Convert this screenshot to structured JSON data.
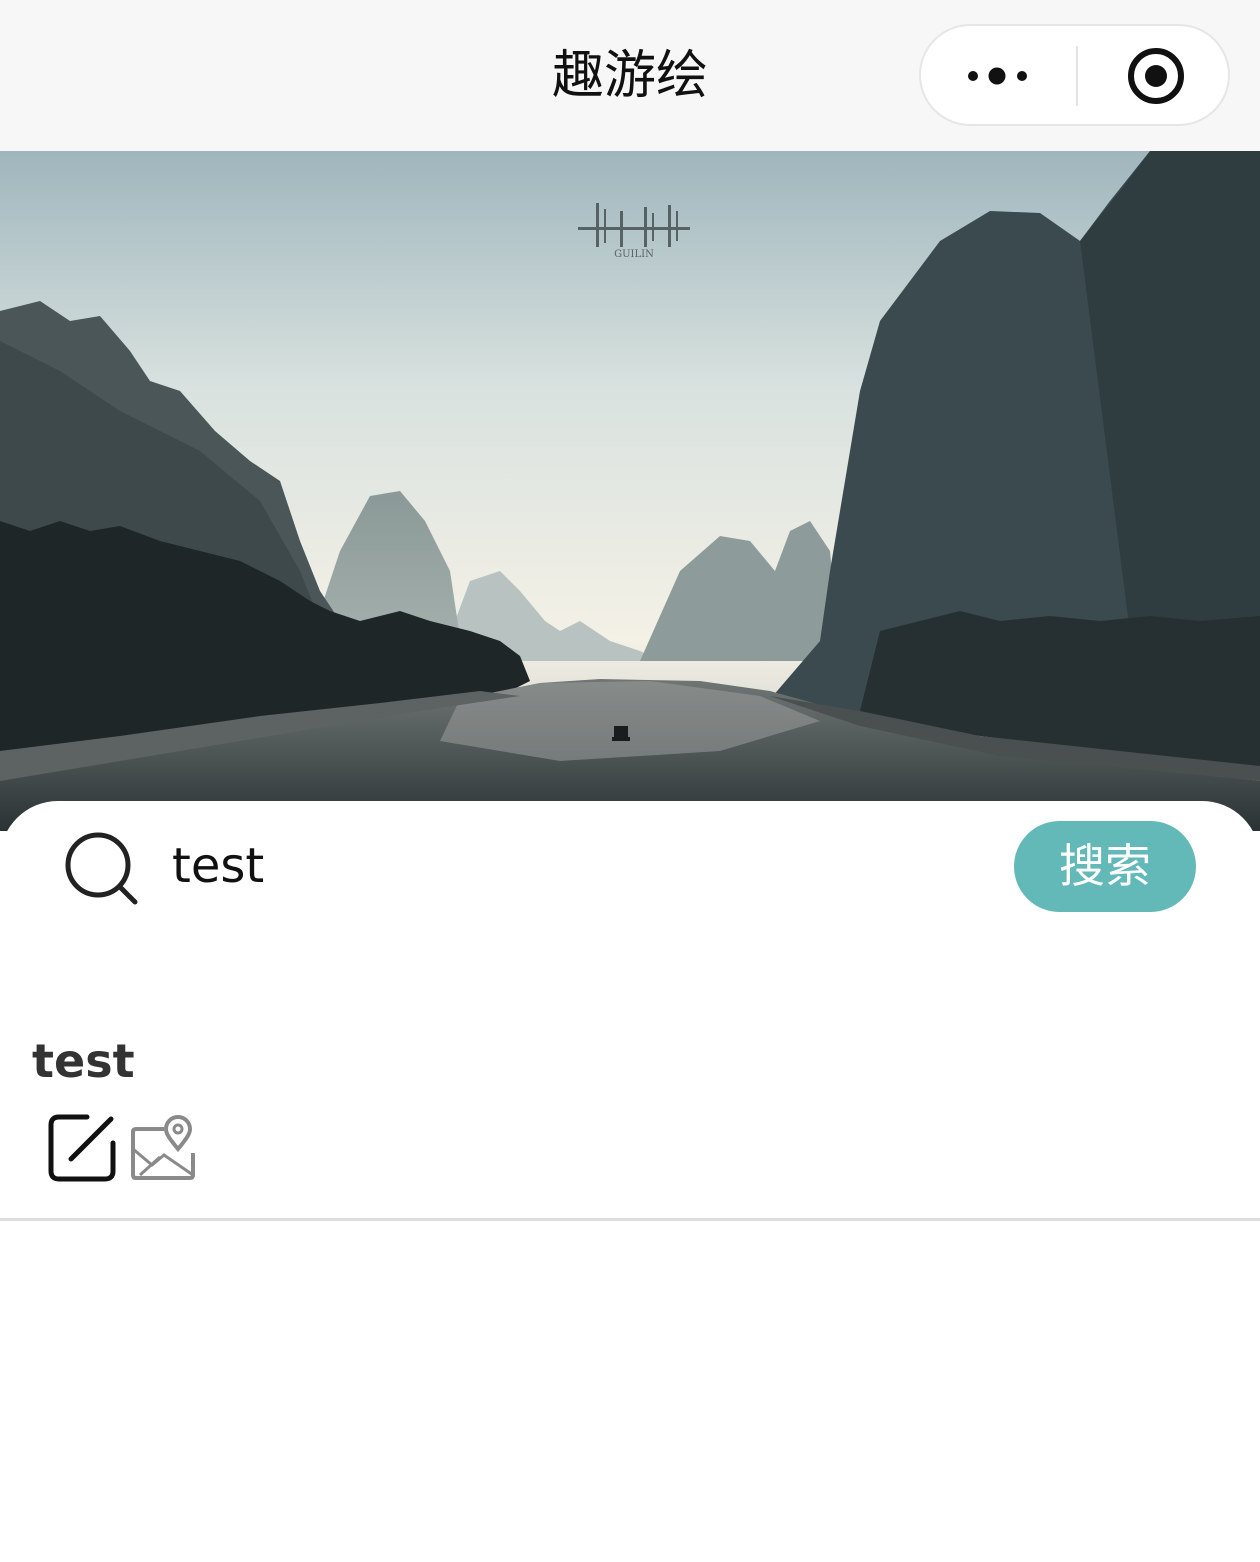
{
  "navbar": {
    "title": "趣游绘",
    "more_icon": "more-dots-icon",
    "close_icon": "close-circle-icon"
  },
  "banner": {
    "logo_text": "GUILIN",
    "image": "karst-mountains-river-landscape"
  },
  "search": {
    "icon": "search-icon",
    "value": "test",
    "button_label": "搜索",
    "button_color": "#62b9b8"
  },
  "results": [
    {
      "title": "test",
      "actions": [
        "edit-icon",
        "map-location-icon"
      ]
    }
  ]
}
